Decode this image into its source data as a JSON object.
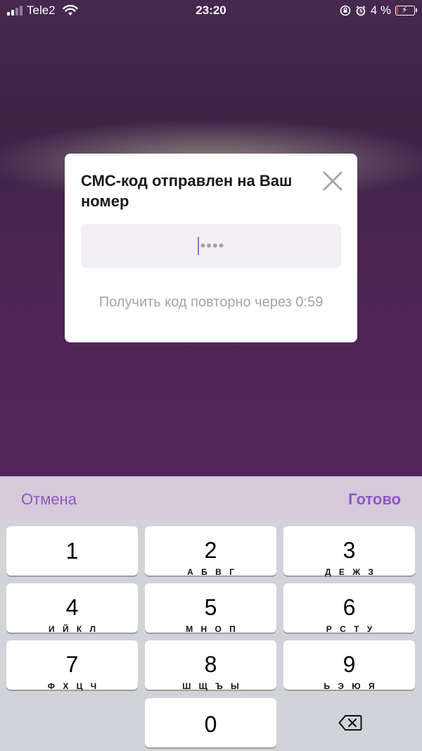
{
  "status_bar": {
    "carrier": "Tele2",
    "time": "23:20",
    "battery_percent": "4 %"
  },
  "modal": {
    "title": "СМС-код отправлен на Ваш номер",
    "code_placeholder": "••••",
    "resend_text": "Получить код повторно через 0:59"
  },
  "toolbar": {
    "cancel_label": "Отмена",
    "done_label": "Готово"
  },
  "keypad": {
    "keys": [
      {
        "digit": "1",
        "letters": ""
      },
      {
        "digit": "2",
        "letters": "А Б В Г"
      },
      {
        "digit": "3",
        "letters": "Д Е Ж З"
      },
      {
        "digit": "4",
        "letters": "И Й К Л"
      },
      {
        "digit": "5",
        "letters": "М Н О П"
      },
      {
        "digit": "6",
        "letters": "Р С Т У"
      },
      {
        "digit": "7",
        "letters": "Ф Х Ц Ч"
      },
      {
        "digit": "8",
        "letters": "Ш Щ Ъ Ы"
      },
      {
        "digit": "9",
        "letters": "Ь Э Ю Я"
      },
      {
        "digit": "0",
        "letters": ""
      }
    ]
  },
  "colors": {
    "accent": "#8e58c4",
    "background": "#4a2552",
    "keyboard_bg": "#d1d3d9"
  },
  "icons": [
    "signal-icon",
    "wifi-icon",
    "rotation-lock-icon",
    "alarm-icon",
    "battery-icon",
    "close-icon",
    "backspace-icon"
  ]
}
